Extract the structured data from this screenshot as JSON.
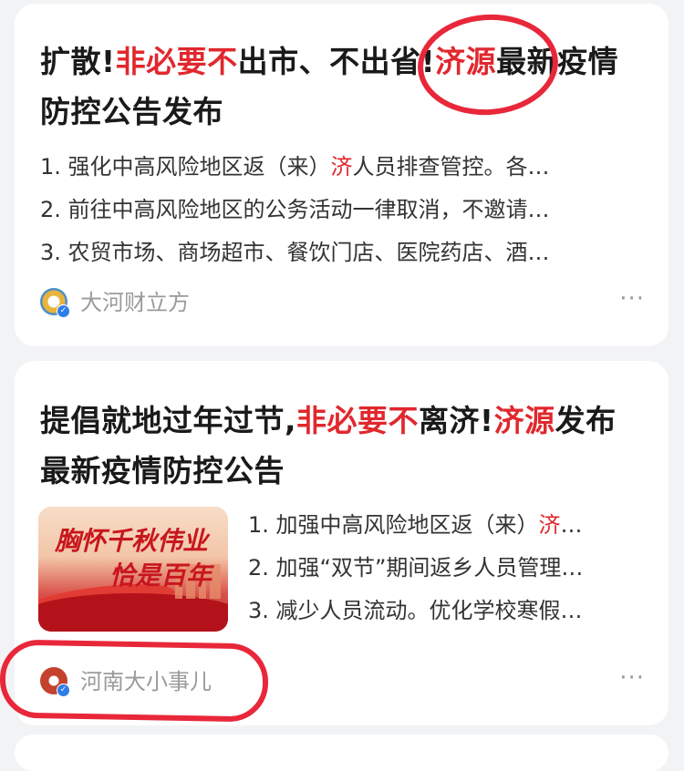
{
  "cards": [
    {
      "title_parts": [
        "扩散!",
        "非必要不",
        "出市、不出省!",
        "济源",
        "最新疫情防控公告发布"
      ],
      "lines": [
        {
          "pre": "1. 强化中高风险地区返（来）",
          "hl": "济",
          "post": "人员排查管控。各…"
        },
        {
          "text": "2. 前往中高风险地区的公务活动一律取消，不邀请…"
        },
        {
          "text": "3. 农贸市场、商场超市、餐饮门店、医院药店、酒…"
        }
      ],
      "author": "大河财立方",
      "more": "···"
    },
    {
      "title_parts": [
        "提倡就地过年过节,",
        "非必要不",
        "离济!",
        "济源",
        "发布最新疫情防控公告"
      ],
      "thumbnail_text": [
        "胸怀千秋伟业",
        "恰是百年"
      ],
      "lines": [
        {
          "pre": "1. 加强中高风险地区返（来）",
          "hl": "济",
          "post": "…"
        },
        {
          "text": "2. 加强“双节”期间返乡人员管理…"
        },
        {
          "text": "3. 减少人员流动。优化学校寒假…"
        }
      ],
      "author": "河南大小事儿",
      "more": "···"
    }
  ],
  "verify_badge": "✓",
  "colors": {
    "highlight": "#e0282e",
    "annotation": "#e8283a",
    "verified": "#2f7ee8"
  }
}
